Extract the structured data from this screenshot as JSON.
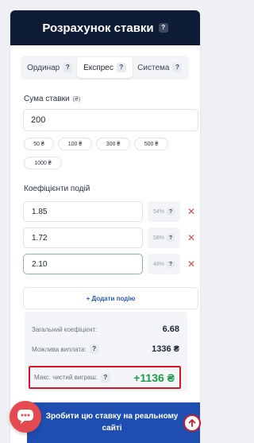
{
  "header": {
    "title": "Розрахунок ставки",
    "help": "?"
  },
  "tabs": [
    {
      "label": "Ординар",
      "help": "?"
    },
    {
      "label": "Експрес",
      "help": "?"
    },
    {
      "label": "Система",
      "help": "?"
    }
  ],
  "active_tab": "Експрес",
  "stake": {
    "label": "Сума ставки",
    "help": "(₴)",
    "value": "200",
    "presets": [
      "50 ₴",
      "100 ₴",
      "300 ₴",
      "500 ₴",
      "1000 ₴"
    ]
  },
  "odds": {
    "label": "Коефіцієнти подій",
    "events": [
      {
        "value": "1.85",
        "probability": "54%",
        "help": "?",
        "remove": "✕"
      },
      {
        "value": "1.72",
        "probability": "58%",
        "help": "?",
        "remove": "✕"
      },
      {
        "value": "2.10",
        "probability": "48%",
        "help": "?",
        "remove": "✕"
      }
    ],
    "add_label": "+ Додати подію"
  },
  "summary": {
    "total_odds_label": "Загальний коефіцієнт:",
    "total_odds_value": "6.68",
    "payout_label": "Можлива виплата:",
    "payout_help": "?",
    "payout_value": "1336 ₴",
    "net_win_label": "Макс. чистий виграш:",
    "net_win_help": "?",
    "net_win_value": "+1136 ₴"
  },
  "cta": {
    "label": "Зробити цю ставку на реальному сайті"
  },
  "colors": {
    "header": "#0e1c36",
    "cta": "#1e4fb0",
    "win": "#1e9b4c",
    "remove": "#d94a4a",
    "highlight": "#cc1a2b"
  },
  "icons": {
    "chat": "chat-bubble-icon",
    "scroll_up": "arrow-up-circle-icon"
  }
}
